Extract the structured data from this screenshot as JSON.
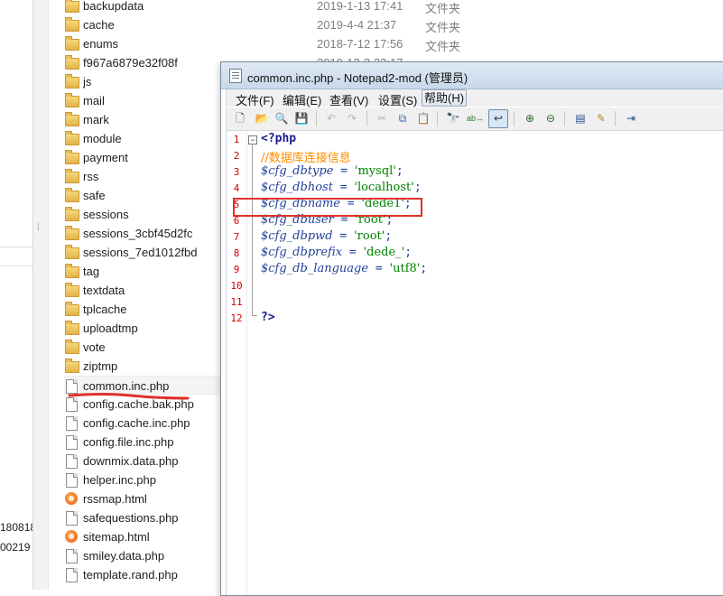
{
  "left_pane": {
    "edge_texts": [
      "180818",
      "00219"
    ]
  },
  "explorer": {
    "rows": [
      {
        "name": "backupdata",
        "type": "folder",
        "date": "2019-1-13 17:41",
        "kind": "文件夹"
      },
      {
        "name": "cache",
        "type": "folder",
        "date": "2019-4-4 21:37",
        "kind": "文件夹"
      },
      {
        "name": "enums",
        "type": "folder",
        "date": "2018-7-12 17:56",
        "kind": "文件夹"
      },
      {
        "name": "f967a6879e32f08f",
        "type": "folder",
        "date": "",
        "kind": ""
      },
      {
        "name": "js",
        "type": "folder",
        "date": "",
        "kind": ""
      },
      {
        "name": "mail",
        "type": "folder",
        "date": "",
        "kind": ""
      },
      {
        "name": "mark",
        "type": "folder",
        "date": "",
        "kind": ""
      },
      {
        "name": "module",
        "type": "folder",
        "date": "",
        "kind": ""
      },
      {
        "name": "payment",
        "type": "folder",
        "date": "",
        "kind": ""
      },
      {
        "name": "rss",
        "type": "folder",
        "date": "",
        "kind": ""
      },
      {
        "name": "safe",
        "type": "folder",
        "date": "",
        "kind": ""
      },
      {
        "name": "sessions",
        "type": "folder",
        "date": "",
        "kind": ""
      },
      {
        "name": "sessions_3cbf45d2fc",
        "type": "folder",
        "date": "",
        "kind": ""
      },
      {
        "name": "sessions_7ed1012fbd",
        "type": "folder",
        "date": "",
        "kind": ""
      },
      {
        "name": "tag",
        "type": "folder",
        "date": "",
        "kind": ""
      },
      {
        "name": "textdata",
        "type": "folder",
        "date": "",
        "kind": ""
      },
      {
        "name": "tplcache",
        "type": "folder",
        "date": "",
        "kind": ""
      },
      {
        "name": "uploadtmp",
        "type": "folder",
        "date": "",
        "kind": ""
      },
      {
        "name": "vote",
        "type": "folder",
        "date": "",
        "kind": ""
      },
      {
        "name": "ziptmp",
        "type": "folder",
        "date": "",
        "kind": ""
      },
      {
        "name": "common.inc.php",
        "type": "file",
        "date": "",
        "kind": "",
        "selected": true
      },
      {
        "name": "config.cache.bak.php",
        "type": "file",
        "date": "",
        "kind": ""
      },
      {
        "name": "config.cache.inc.php",
        "type": "file",
        "date": "",
        "kind": ""
      },
      {
        "name": "config.file.inc.php",
        "type": "file",
        "date": "",
        "kind": ""
      },
      {
        "name": "downmix.data.php",
        "type": "file",
        "date": "",
        "kind": ""
      },
      {
        "name": "helper.inc.php",
        "type": "file",
        "date": "",
        "kind": ""
      },
      {
        "name": "rssmap.html",
        "type": "html",
        "date": "",
        "kind": ""
      },
      {
        "name": "safequestions.php",
        "type": "file",
        "date": "",
        "kind": ""
      },
      {
        "name": "sitemap.html",
        "type": "html",
        "date": "",
        "kind": ""
      },
      {
        "name": "smiley.data.php",
        "type": "file",
        "date": "",
        "kind": ""
      },
      {
        "name": "template.rand.php",
        "type": "file",
        "date": "",
        "kind": ""
      }
    ],
    "partial_date_behind_window": "2019-12-3 22:17"
  },
  "notepad": {
    "title": "common.inc.php - Notepad2-mod (管理员)",
    "menu": [
      {
        "label": "文件(F)"
      },
      {
        "label": "编辑(E)"
      },
      {
        "label": "查看(V)"
      },
      {
        "label": "设置(S)"
      },
      {
        "label": "帮助(H)",
        "active": true
      }
    ],
    "toolbar_icons": [
      "new-file-icon",
      "open-file-icon",
      "browse-icon",
      "save-icon",
      "undo-icon",
      "redo-icon",
      "cut-icon",
      "copy-icon",
      "paste-icon",
      "find-icon",
      "replace-icon",
      "word-wrap-icon",
      "zoom-in-icon",
      "zoom-out-icon",
      "settings-icon",
      "customize-icon",
      "exit-icon"
    ],
    "line_numbers": [
      "1",
      "2",
      "3",
      "4",
      "5",
      "6",
      "7",
      "8",
      "9",
      "10",
      "11",
      "12"
    ],
    "code": {
      "l1": "<?php",
      "l2": "//数据库连接信息",
      "l3_var": "$cfg_dbtype",
      "l3_val": "'mysql'",
      "l4_var": "$cfg_dbhost",
      "l4_val": "'localhost'",
      "l5_var": "$cfg_dbname",
      "l5_val": "'dede1'",
      "l6_var": "$cfg_dbuser",
      "l6_val": "'root'",
      "l7_var": "$cfg_dbpwd",
      "l7_val": "'root'",
      "l8_var": "$cfg_dbprefix",
      "l8_val": "'dede_'",
      "l9_var": "$cfg_db_language",
      "l9_val": "'utf8'",
      "l12": "?>",
      "eq": " = ",
      "semi": ";"
    },
    "fold_marker": "−"
  },
  "colors": {
    "highlight_box": "#e0302a",
    "underline": "#e0302a",
    "line_number": "#d10000",
    "comment": "#ff8c00",
    "string": "#008000",
    "variable": "#1f3f99"
  }
}
